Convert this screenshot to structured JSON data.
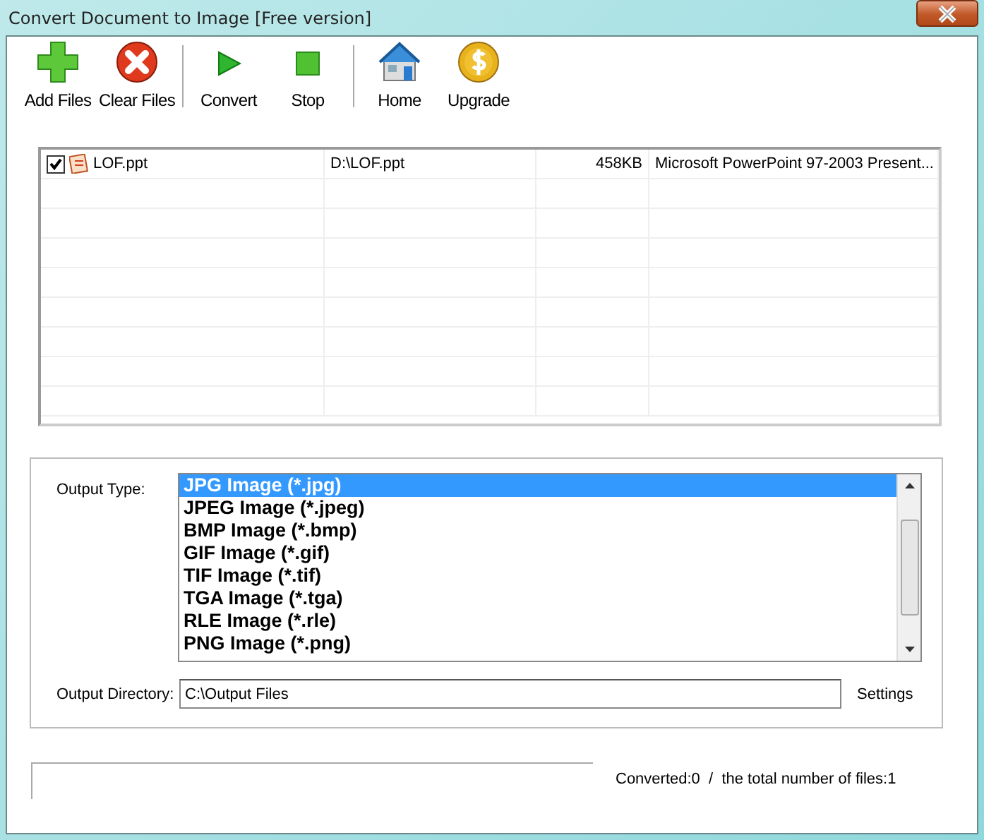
{
  "window": {
    "title": "Convert Document to Image [Free version]"
  },
  "toolbar": [
    {
      "kind": "add",
      "label": "Add Files"
    },
    {
      "kind": "clear",
      "label": "Clear Files"
    },
    {
      "kind": "separator"
    },
    {
      "kind": "convert",
      "label": "Convert"
    },
    {
      "kind": "stop",
      "label": "Stop"
    },
    {
      "kind": "separator"
    },
    {
      "kind": "home",
      "label": "Home"
    },
    {
      "kind": "upgrade",
      "label": "Upgrade"
    }
  ],
  "files": [
    {
      "checked": true,
      "name": "LOF.ppt",
      "path": "D:\\LOF.ppt",
      "size": "458KB",
      "type": "Microsoft PowerPoint 97-2003 Present..."
    }
  ],
  "output": {
    "type_label": "Output Type:",
    "types": [
      {
        "label": "JPG Image (*.jpg)",
        "selected": true
      },
      {
        "label": "JPEG Image (*.jpeg)",
        "selected": false
      },
      {
        "label": "BMP Image (*.bmp)",
        "selected": false
      },
      {
        "label": "GIF Image (*.gif)",
        "selected": false
      },
      {
        "label": "TIF Image (*.tif)",
        "selected": false
      },
      {
        "label": "TGA Image (*.tga)",
        "selected": false
      },
      {
        "label": "RLE Image (*.rle)",
        "selected": false
      },
      {
        "label": "PNG Image (*.png)",
        "selected": false
      }
    ],
    "directory_label": "Output Directory:",
    "directory": "C:\\Output Files",
    "settings": "Settings"
  },
  "status": {
    "progress": {
      "level": 0
    },
    "text": "Converted:0  /  the total number of files:1"
  }
}
